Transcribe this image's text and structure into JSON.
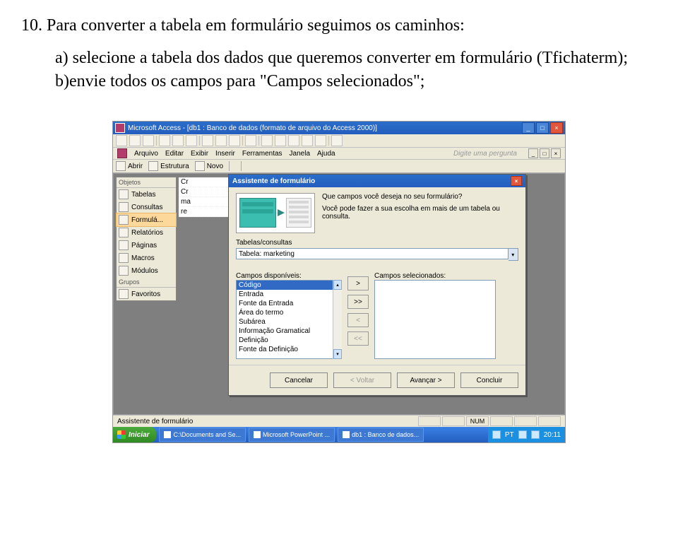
{
  "doc": {
    "line1": "10. Para converter a tabela em formulário seguimos os caminhos:",
    "point_a": "a) selecione a tabela dos dados que queremos converter em formulário (Tfichaterm);",
    "point_b": "b)envie todos os campos para \"Campos selecionados\";"
  },
  "app": {
    "title": "Microsoft Access - [db1 : Banco de dados (formato de arquivo do Access 2000)]",
    "menu": [
      "Arquivo",
      "Editar",
      "Exibir",
      "Inserir",
      "Ferramentas",
      "Janela",
      "Ajuda"
    ],
    "ask_placeholder": "Digite uma pergunta",
    "toolbar2": {
      "abrir": "Abrir",
      "estrutura": "Estrutura",
      "novo": "Novo"
    },
    "status_left": "Assistente de formulário",
    "status_num": "NUM"
  },
  "dbwin": {
    "objects_label": "Objetos",
    "items": [
      {
        "label": "Tabelas"
      },
      {
        "label": "Consultas"
      },
      {
        "label": "Formulá..."
      },
      {
        "label": "Relatórios"
      },
      {
        "label": "Páginas"
      },
      {
        "label": "Macros"
      },
      {
        "label": "Módulos"
      }
    ],
    "groups_label": "Grupos",
    "favorites": "Favoritos"
  },
  "minilist": {
    "rows": [
      "Cr",
      "Cr",
      "ma",
      "re"
    ]
  },
  "wizard": {
    "title": "Assistente de formulário",
    "q1": "Que campos você deseja no seu formulário?",
    "q2": "Você pode fazer a sua escolha em mais de um tabela ou consulta.",
    "tables_label": "Tabelas/consultas",
    "combo_value": "Tabela: marketing",
    "avail_label": "Campos disponíveis:",
    "sel_label": "Campos selecionados:",
    "avail_items": [
      "Código",
      "Entrada",
      "Fonte da Entrada",
      "Área do termo",
      "Subárea",
      "Informação Gramatical",
      "Definição",
      "Fonte da Definição"
    ],
    "btn_gt": ">",
    "btn_gtgt": ">>",
    "btn_lt": "<",
    "btn_ltlt": "<<",
    "cancel": "Cancelar",
    "back": "< Voltar",
    "next": "Avançar >",
    "finish": "Concluir"
  },
  "taskbar": {
    "start": "Iniciar",
    "tasks": [
      "C:\\Documents and Se...",
      "Microsoft PowerPoint ...",
      "db1 : Banco de dados..."
    ],
    "lang": "PT",
    "clock": "20:11"
  }
}
